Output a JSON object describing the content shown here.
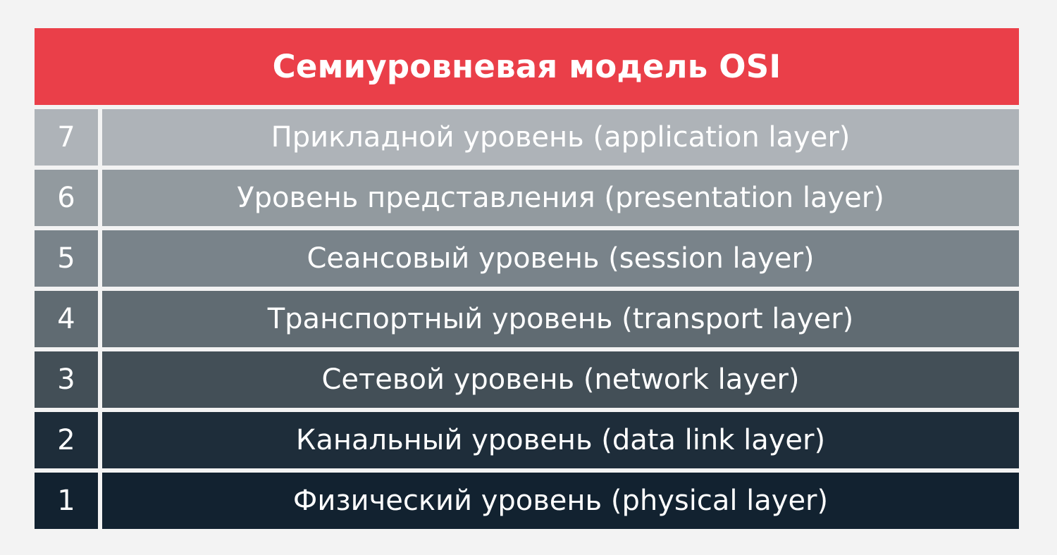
{
  "title": "Семиуровневая модель OSI",
  "colors": {
    "title_bg": "#ea3f49",
    "background": "#f3f3f3",
    "text": "#ffffff"
  },
  "layers": [
    {
      "number": "7",
      "name": "Прикладной уровень (application layer)",
      "color": "#aeb3b8"
    },
    {
      "number": "6",
      "name": "Уровень представления (presentation layer)",
      "color": "#929a9f"
    },
    {
      "number": "5",
      "name": "Сеансовый уровень (session layer)",
      "color": "#79838a"
    },
    {
      "number": "4",
      "name": "Транспортный уровень (transport layer)",
      "color": "#606b72"
    },
    {
      "number": "3",
      "name": "Сетевой уровень (network layer)",
      "color": "#434f57"
    },
    {
      "number": "2",
      "name": "Канальный уровень (data link layer)",
      "color": "#1e2d3a"
    },
    {
      "number": "1",
      "name": "Физический уровень (physical layer)",
      "color": "#122230"
    }
  ]
}
